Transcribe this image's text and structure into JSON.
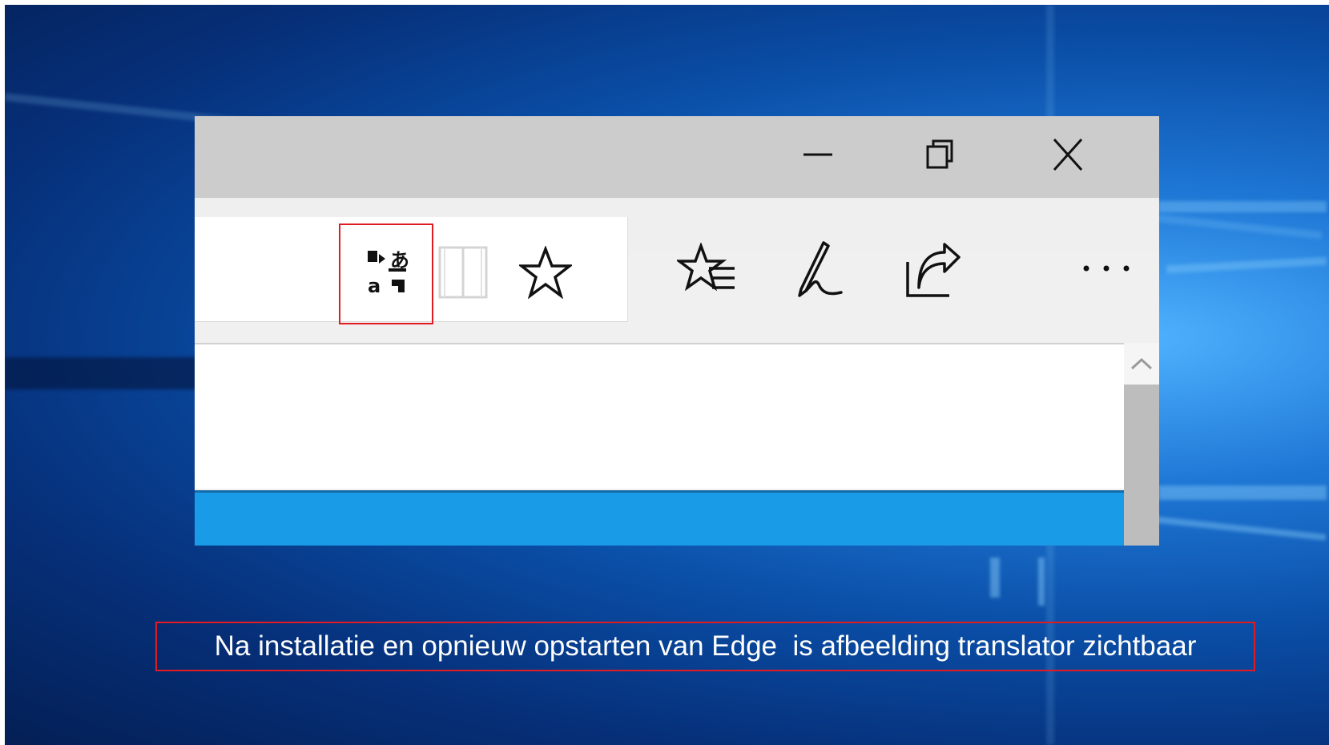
{
  "browser": {
    "window_controls": {
      "minimize_icon": "minimize-icon",
      "restore_icon": "restore-icon",
      "close_icon": "close-icon"
    },
    "address_icons": [
      "translator-icon",
      "reading-view-icon",
      "favorite-star-icon"
    ],
    "toolbar_icons": [
      "favorites-hub-icon",
      "web-note-icon",
      "share-icon",
      "more-icon"
    ]
  },
  "caption": {
    "text": "Na installatie en opnieuw opstarten van Edge  is afbeelding translator zichtbaar"
  },
  "colors": {
    "highlight": "#e11b22",
    "accent_blue": "#1a9be8"
  }
}
